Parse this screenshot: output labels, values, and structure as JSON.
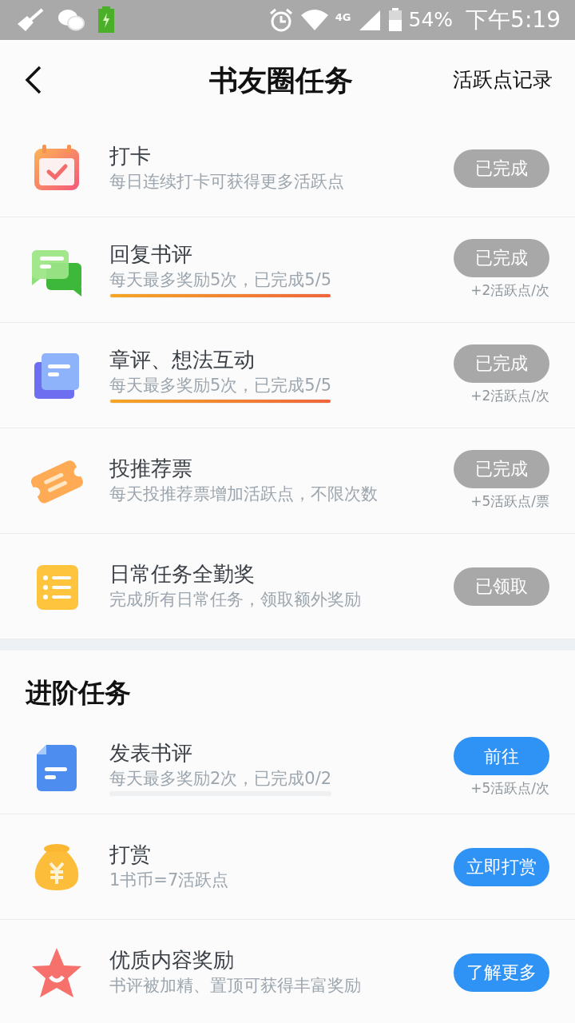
{
  "status_bar": {
    "network": "4G",
    "battery": "54%",
    "time": "下午5:19"
  },
  "header": {
    "title": "书友圈任务",
    "action": "活跃点记录"
  },
  "daily_tasks": [
    {
      "kind": "calendar",
      "title": "打卡",
      "desc": "每日连续打卡可获得更多活跃点",
      "button": {
        "label": "已完成",
        "kind": "done"
      }
    },
    {
      "kind": "chat",
      "title": "回复书评",
      "desc": "每天最多奖励5次，已完成5/5",
      "level": 1,
      "button": {
        "label": "已完成",
        "kind": "done"
      },
      "reward": "+2活跃点/次"
    },
    {
      "kind": "notes",
      "title": "章评、想法互动",
      "desc": "每天最多奖励5次，已完成5/5",
      "level": 1,
      "button": {
        "label": "已完成",
        "kind": "done"
      },
      "reward": "+2活跃点/次"
    },
    {
      "kind": "ticket",
      "title": "投推荐票",
      "desc": "每天投推荐票增加活跃点，不限次数",
      "button": {
        "label": "已完成",
        "kind": "done"
      },
      "reward": "+5活跃点/票"
    },
    {
      "kind": "list",
      "title": "日常任务全勤奖",
      "desc": "完成所有日常任务，领取额外奖励",
      "button": {
        "label": "已领取",
        "kind": "done"
      }
    }
  ],
  "advanced": {
    "title": "进阶任务",
    "tasks": [
      {
        "kind": "document",
        "title": "发表书评",
        "desc": "每天最多奖励2次，已完成0/2",
        "level": 0,
        "button": {
          "label": "前往",
          "kind": "action"
        },
        "reward": "+5活跃点/次"
      },
      {
        "kind": "moneybag",
        "title": "打赏",
        "desc": "1书币=7活跃点",
        "button": {
          "label": "立即打赏",
          "kind": "action"
        }
      },
      {
        "kind": "star",
        "title": "优质内容奖励",
        "desc": "书评被加精、置顶可获得丰富奖励",
        "button": {
          "label": "了解更多",
          "kind": "action"
        }
      }
    ]
  }
}
